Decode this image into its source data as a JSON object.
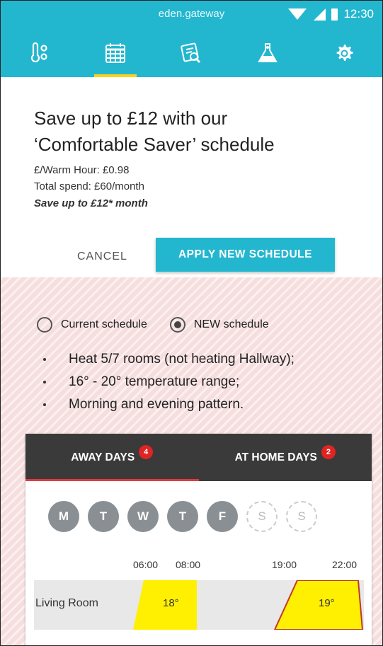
{
  "status_bar": {
    "url": "eden.gateway",
    "time": "12:30"
  },
  "nav_tabs": [
    {
      "icon": "thermometer-icon"
    },
    {
      "icon": "calendar-icon",
      "active": true
    },
    {
      "icon": "report-icon"
    },
    {
      "icon": "flask-icon"
    },
    {
      "icon": "gear-icon"
    }
  ],
  "offer": {
    "title_line1": "Save up to £12 with our",
    "title_line2": "‘Comfortable Saver’ schedule",
    "warm_hour": "£/Warm Hour: £0.98",
    "total_spend": "Total spend: £60/month",
    "save_line": "Save up to £12* month",
    "cancel_label": "CANCEL",
    "apply_label": "APPLY NEW SCHEDULE"
  },
  "schedule_choice": {
    "current_label": "Current schedule",
    "new_label": "NEW schedule",
    "selected": "new"
  },
  "bullets": [
    "Heat 5/7 rooms (not heating Hallway);",
    "16° - 20° temperature range;",
    "Morning and evening pattern."
  ],
  "card": {
    "tabs": [
      {
        "label": "AWAY DAYS",
        "badge": "4",
        "active": true
      },
      {
        "label": "AT HOME DAYS",
        "badge": "2"
      }
    ],
    "days": [
      {
        "letter": "M",
        "selected": true
      },
      {
        "letter": "T",
        "selected": true
      },
      {
        "letter": "W",
        "selected": true
      },
      {
        "letter": "T",
        "selected": true
      },
      {
        "letter": "F",
        "selected": true
      },
      {
        "letter": "S",
        "selected": false
      },
      {
        "letter": "S",
        "selected": false
      }
    ],
    "times": [
      "06:00",
      "08:00",
      "19:00",
      "22:00"
    ],
    "rooms": [
      {
        "name": "Living Room",
        "morning_temp": "18°",
        "evening_temp": "19°"
      }
    ],
    "colors": {
      "heat_block": "#ffef00",
      "heat_block_border": "#c0392b"
    }
  }
}
